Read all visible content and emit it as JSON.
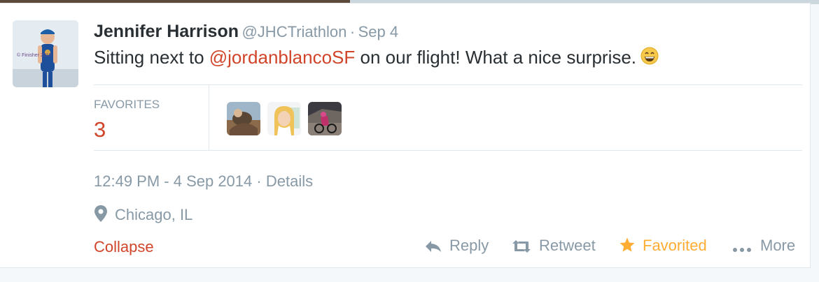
{
  "tweet": {
    "full_name": "Jennifer Harrison",
    "handle": "@JHCTriathlon",
    "separator": "·",
    "date": "Sep 4",
    "text_before": "Sitting next to ",
    "mention": "@jordanblancoSF",
    "text_after": " on our flight!  What a nice surprise.",
    "emoji": "grinning-face-emoji"
  },
  "stats": {
    "favorites_label": "FAVORITES",
    "favorites_count": "3",
    "favoriter_avatars": [
      "avatar-1",
      "avatar-2",
      "avatar-3"
    ]
  },
  "details": {
    "timestamp": "12:49 PM - 4 Sep 2014",
    "separator": "·",
    "details_link": "Details",
    "location": "Chicago, IL"
  },
  "actions": {
    "collapse": "Collapse",
    "reply": "Reply",
    "retweet": "Retweet",
    "favorited": "Favorited",
    "more": "More"
  },
  "colors": {
    "accent": "#d0452a",
    "favorite": "#ffac33",
    "muted": "#8899a6",
    "text": "#292f33"
  }
}
